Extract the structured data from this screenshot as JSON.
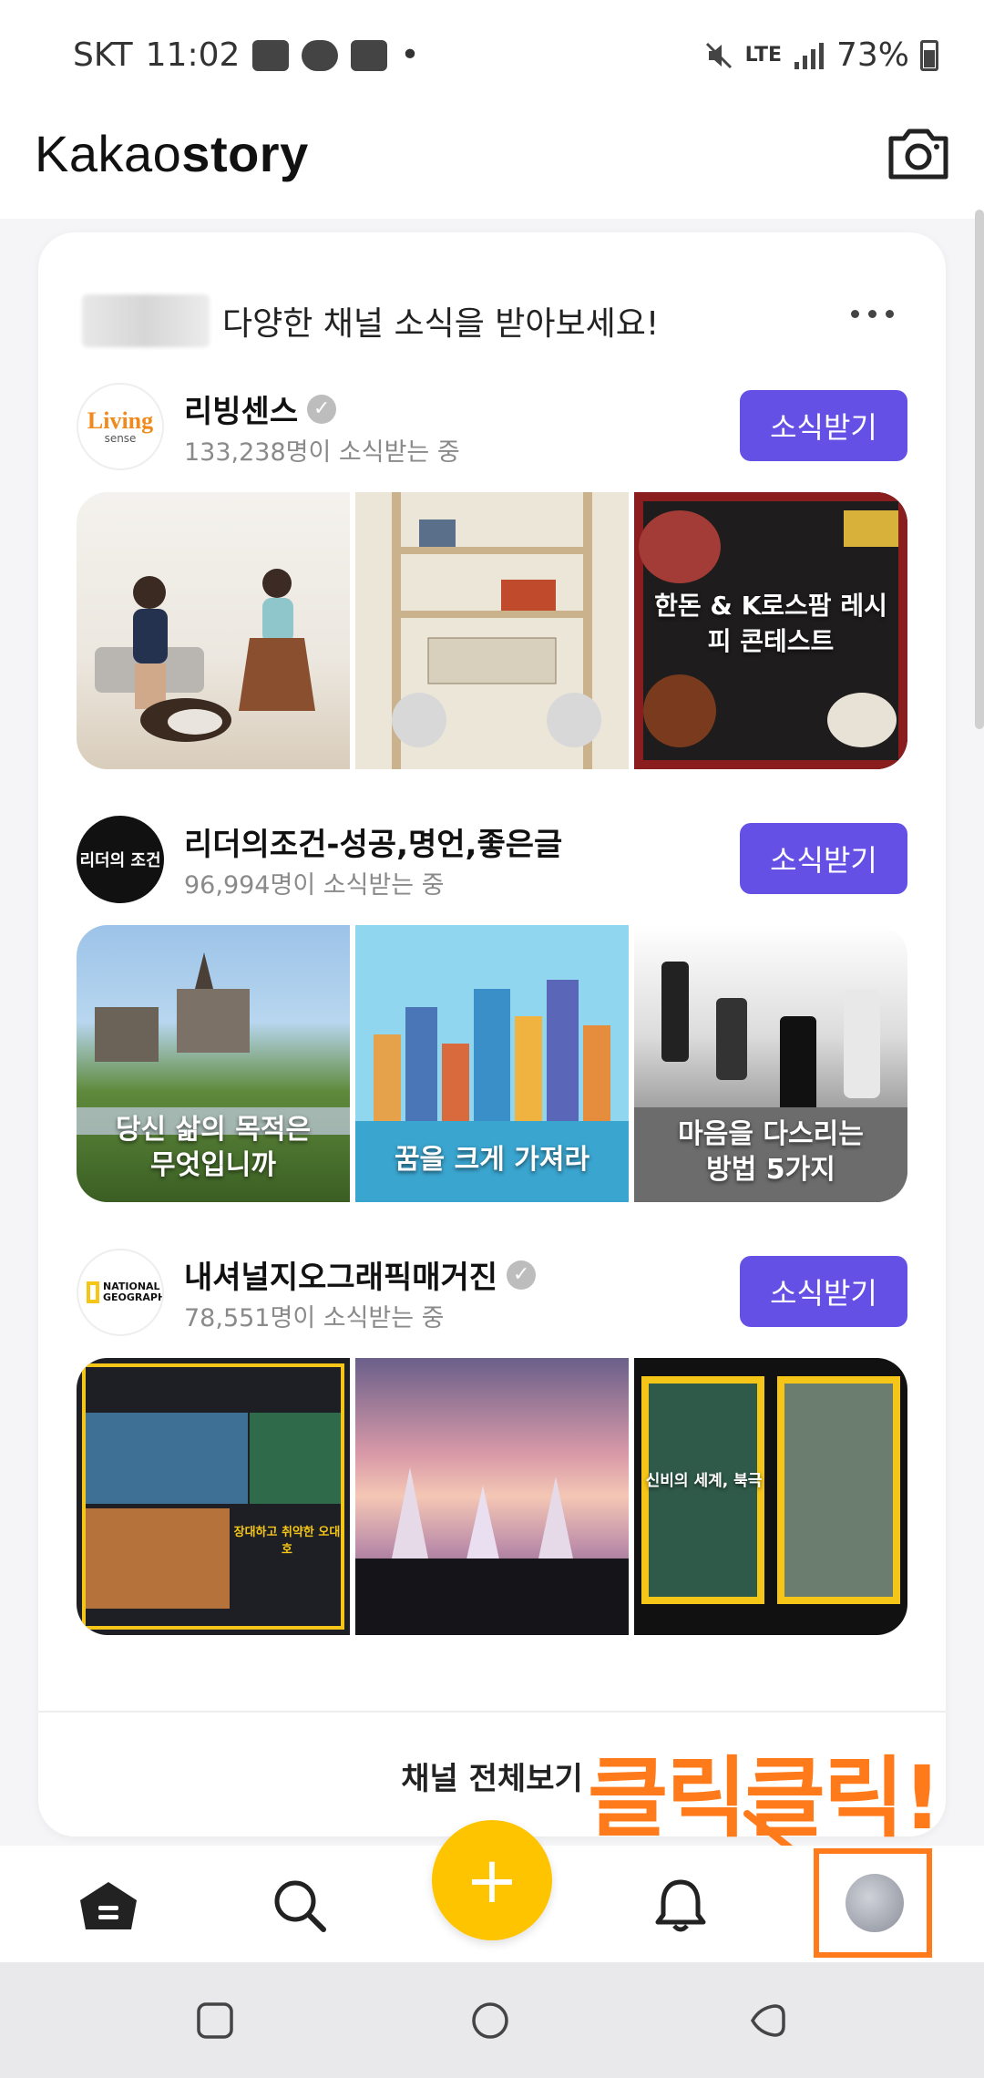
{
  "status_bar": {
    "carrier": "SKT",
    "time": "11:02",
    "network": "LTE",
    "battery": "73%"
  },
  "header": {
    "brand_light": "Kakao",
    "brand_bold": "story"
  },
  "card": {
    "title": "다양한 채널 소식을 받아보세요!",
    "view_all": "채널 전체보기",
    "channels": [
      {
        "name": "리빙센스",
        "avatar_text": "Living",
        "avatar_sub": "sense",
        "subscribers": "133,238명이 소식받는 중",
        "button": "소식받기",
        "verified": true,
        "thumb_captions": [
          "",
          "",
          "한돈 & K로스팜 레시피 콘테스트"
        ]
      },
      {
        "name": "리더의조건-성공,명언,좋은글",
        "avatar_text": "리더의 조건",
        "subscribers": "96,994명이 소식받는 중",
        "button": "소식받기",
        "verified": false,
        "thumb_captions": [
          "당신 삶의 목적은 무엇입니까",
          "꿈을 크게 가져라",
          "마음을 다스리는 방법 5가지"
        ]
      },
      {
        "name": "내셔널지오그래픽매거진",
        "avatar_text": "NATIONAL GEOGRAPHIC",
        "subscribers": "78,551명이 소식받는 중",
        "button": "소식받기",
        "verified": true,
        "thumb_captions": [
          "장대하고 취약한 오대호",
          "",
          "신비의 세계, 북극"
        ]
      }
    ]
  },
  "annotation": {
    "text": "클릭클릭!"
  },
  "bottom_nav": {
    "items": [
      "home-icon",
      "search-icon",
      "add-icon",
      "bell-icon",
      "profile-avatar"
    ]
  },
  "colors": {
    "subscribe": "#6550e6",
    "fab": "#ffc400",
    "annotation": "#ff7a1a"
  }
}
